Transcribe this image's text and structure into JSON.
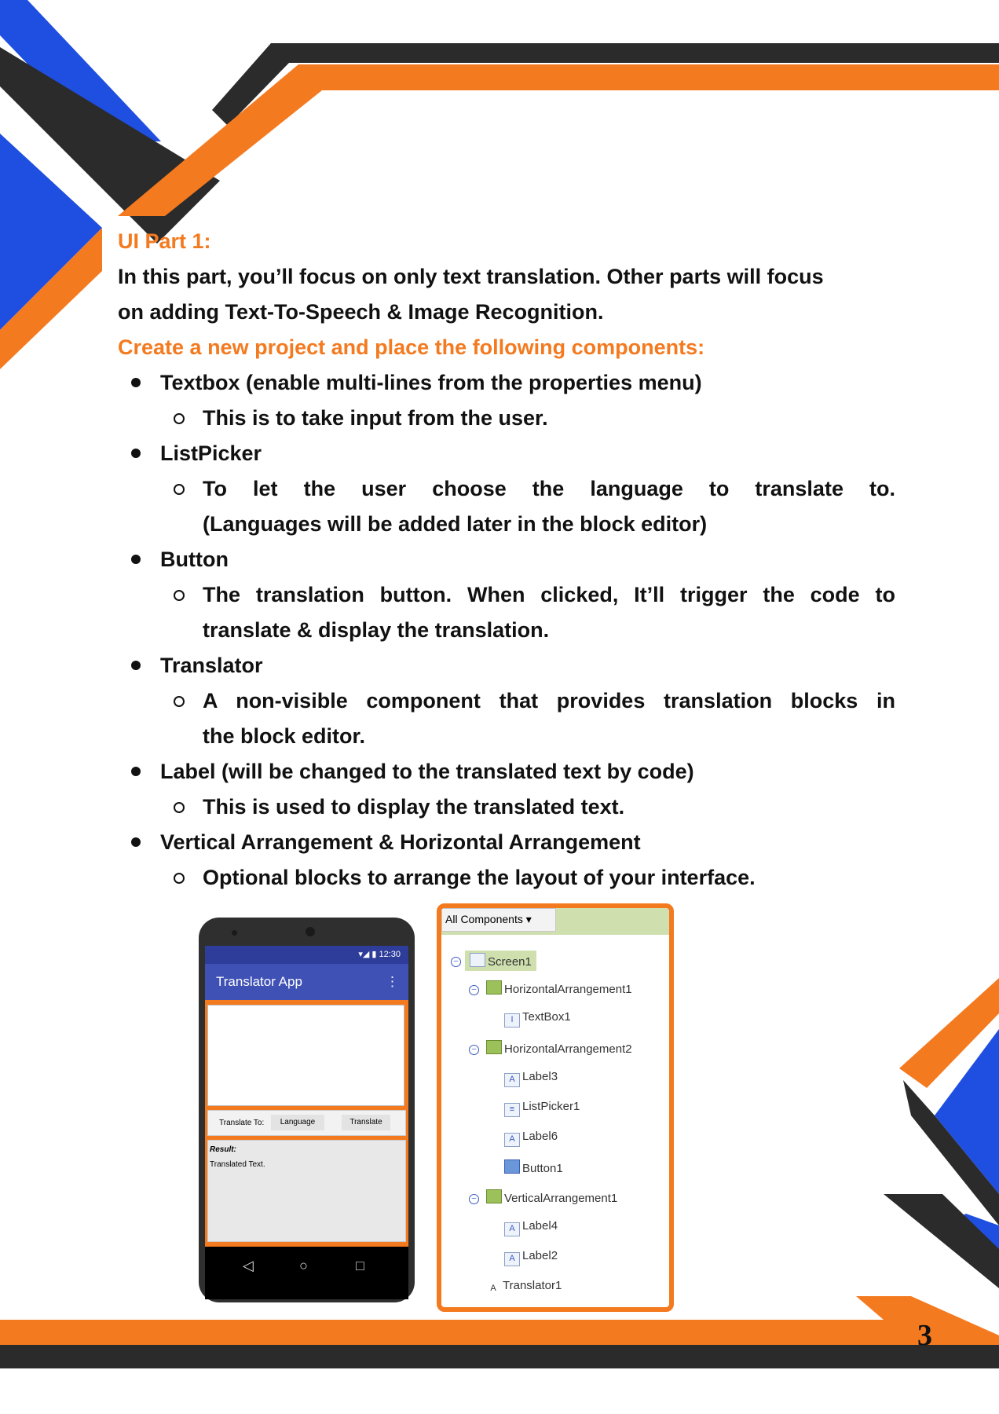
{
  "heading": "UI Part 1:",
  "intro": [
    "In this part, you’ll focus on only text translation. Other parts will focus",
    "on adding Text-To-Speech & Image Recognition."
  ],
  "instruction": "Create a new project and place the following components:",
  "items": [
    {
      "label": "Textbox (enable multi-lines from the properties menu)",
      "sub": [
        "This is to take input from the user."
      ]
    },
    {
      "label": "ListPicker",
      "sub": [
        "To let the user choose the language to translate to.",
        "(Languages will be added later in the block editor)"
      ]
    },
    {
      "label": "Button",
      "sub": [
        "The translation button. When clicked, It’ll trigger the code to",
        "translate & display the translation."
      ]
    },
    {
      "label": "Translator",
      "sub": [
        "A non-visible component that provides translation blocks in",
        "the block editor."
      ]
    },
    {
      "label": "Label (will be changed to the translated text by code)",
      "sub": [
        "This is used to display the translated text."
      ]
    },
    {
      "label": "Vertical Arrangement & Horizontal Arrangement",
      "sub": [
        "Optional blocks to arrange the layout of your interface."
      ]
    }
  ],
  "phone": {
    "time": "12:30",
    "app_title": "Translator App",
    "translate_to_label": "Translate To:",
    "language_button": "Language",
    "translate_button": "Translate",
    "result_label": "Result:",
    "translated_text": "Translated Text."
  },
  "tree": {
    "header": "All Components",
    "nodes": {
      "screen1": "Screen1",
      "ha1": "HorizontalArrangement1",
      "textbox1": "TextBox1",
      "ha2": "HorizontalArrangement2",
      "label3": "Label3",
      "listpicker1": "ListPicker1",
      "label6": "Label6",
      "button1": "Button1",
      "va1": "VerticalArrangement1",
      "label4": "Label4",
      "label2": "Label2",
      "translator1": "Translator1"
    }
  },
  "page_number": "3",
  "colors": {
    "orange": "#f47a20",
    "blue": "#1f4fe0",
    "dark": "#2b2b2b"
  }
}
